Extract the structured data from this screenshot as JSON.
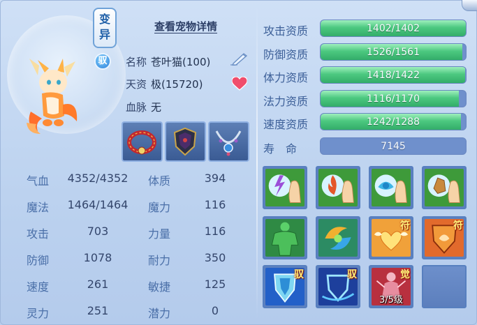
{
  "header": {
    "detail_link": "查看宠物详情"
  },
  "badges": {
    "mutation": [
      "变",
      "异"
    ],
    "tamed": "驭"
  },
  "pet_info": {
    "name_label": "名称",
    "name_value": "苍叶猫(100)",
    "talent_label": "天资",
    "talent_value": "极(15720)",
    "bloodline_label": "血脉",
    "bloodline_value": "无"
  },
  "equipment": [
    {
      "icon": "red-collar-icon"
    },
    {
      "icon": "dark-armor-icon"
    },
    {
      "icon": "jewel-necklace-icon"
    }
  ],
  "stats_left": [
    {
      "label": "气血",
      "value": "4352/4352"
    },
    {
      "label": "魔法",
      "value": "1464/1464"
    },
    {
      "label": "攻击",
      "value": "703"
    },
    {
      "label": "防御",
      "value": "1078"
    },
    {
      "label": "速度",
      "value": "261"
    },
    {
      "label": "灵力",
      "value": "251"
    }
  ],
  "stats_right": [
    {
      "label": "体质",
      "value": "394"
    },
    {
      "label": "魔力",
      "value": "116"
    },
    {
      "label": "力量",
      "value": "116"
    },
    {
      "label": "耐力",
      "value": "350"
    },
    {
      "label": "敏捷",
      "value": "125"
    },
    {
      "label": "潜力",
      "value": "0"
    }
  ],
  "aptitudes": [
    {
      "label": "攻击资质",
      "text": "1402/1402",
      "fill": 1.0
    },
    {
      "label": "防御资质",
      "text": "1526/1561",
      "fill": 0.9776
    },
    {
      "label": "体力资质",
      "text": "1418/1422",
      "fill": 0.9972
    },
    {
      "label": "法力资质",
      "text": "1116/1170",
      "fill": 0.9538
    },
    {
      "label": "速度资质",
      "text": "1242/1288",
      "fill": 0.9643
    }
  ],
  "lifespan": {
    "label": "寿　命",
    "value": "7145"
  },
  "skills": [
    {
      "icon": "lightning-hand-icon",
      "tag": "",
      "level": ""
    },
    {
      "icon": "fire-hand-icon",
      "tag": "",
      "level": ""
    },
    {
      "icon": "water-hand-icon",
      "tag": "",
      "level": ""
    },
    {
      "icon": "earth-hand-icon",
      "tag": "",
      "level": ""
    },
    {
      "icon": "green-strongman-icon",
      "tag": "",
      "level": ""
    },
    {
      "icon": "swirl-elements-icon",
      "tag": "",
      "level": ""
    },
    {
      "icon": "winged-heart-icon",
      "tag": "符",
      "level": ""
    },
    {
      "icon": "shield-swirl-icon",
      "tag": "符",
      "level": ""
    },
    {
      "icon": "blue-shield-icon",
      "tag": "驭",
      "level": ""
    },
    {
      "icon": "shield-outline-icon",
      "tag": "驭",
      "level": ""
    },
    {
      "icon": "awakened-figure-icon",
      "tag": "觉",
      "level": "3/5级"
    },
    {
      "icon": "empty-slot",
      "tag": "",
      "level": ""
    }
  ],
  "colors": {
    "bar_fill": "#3fbd74",
    "bar_track": "#6f90cc",
    "label_blue": "#4a6fa8"
  }
}
